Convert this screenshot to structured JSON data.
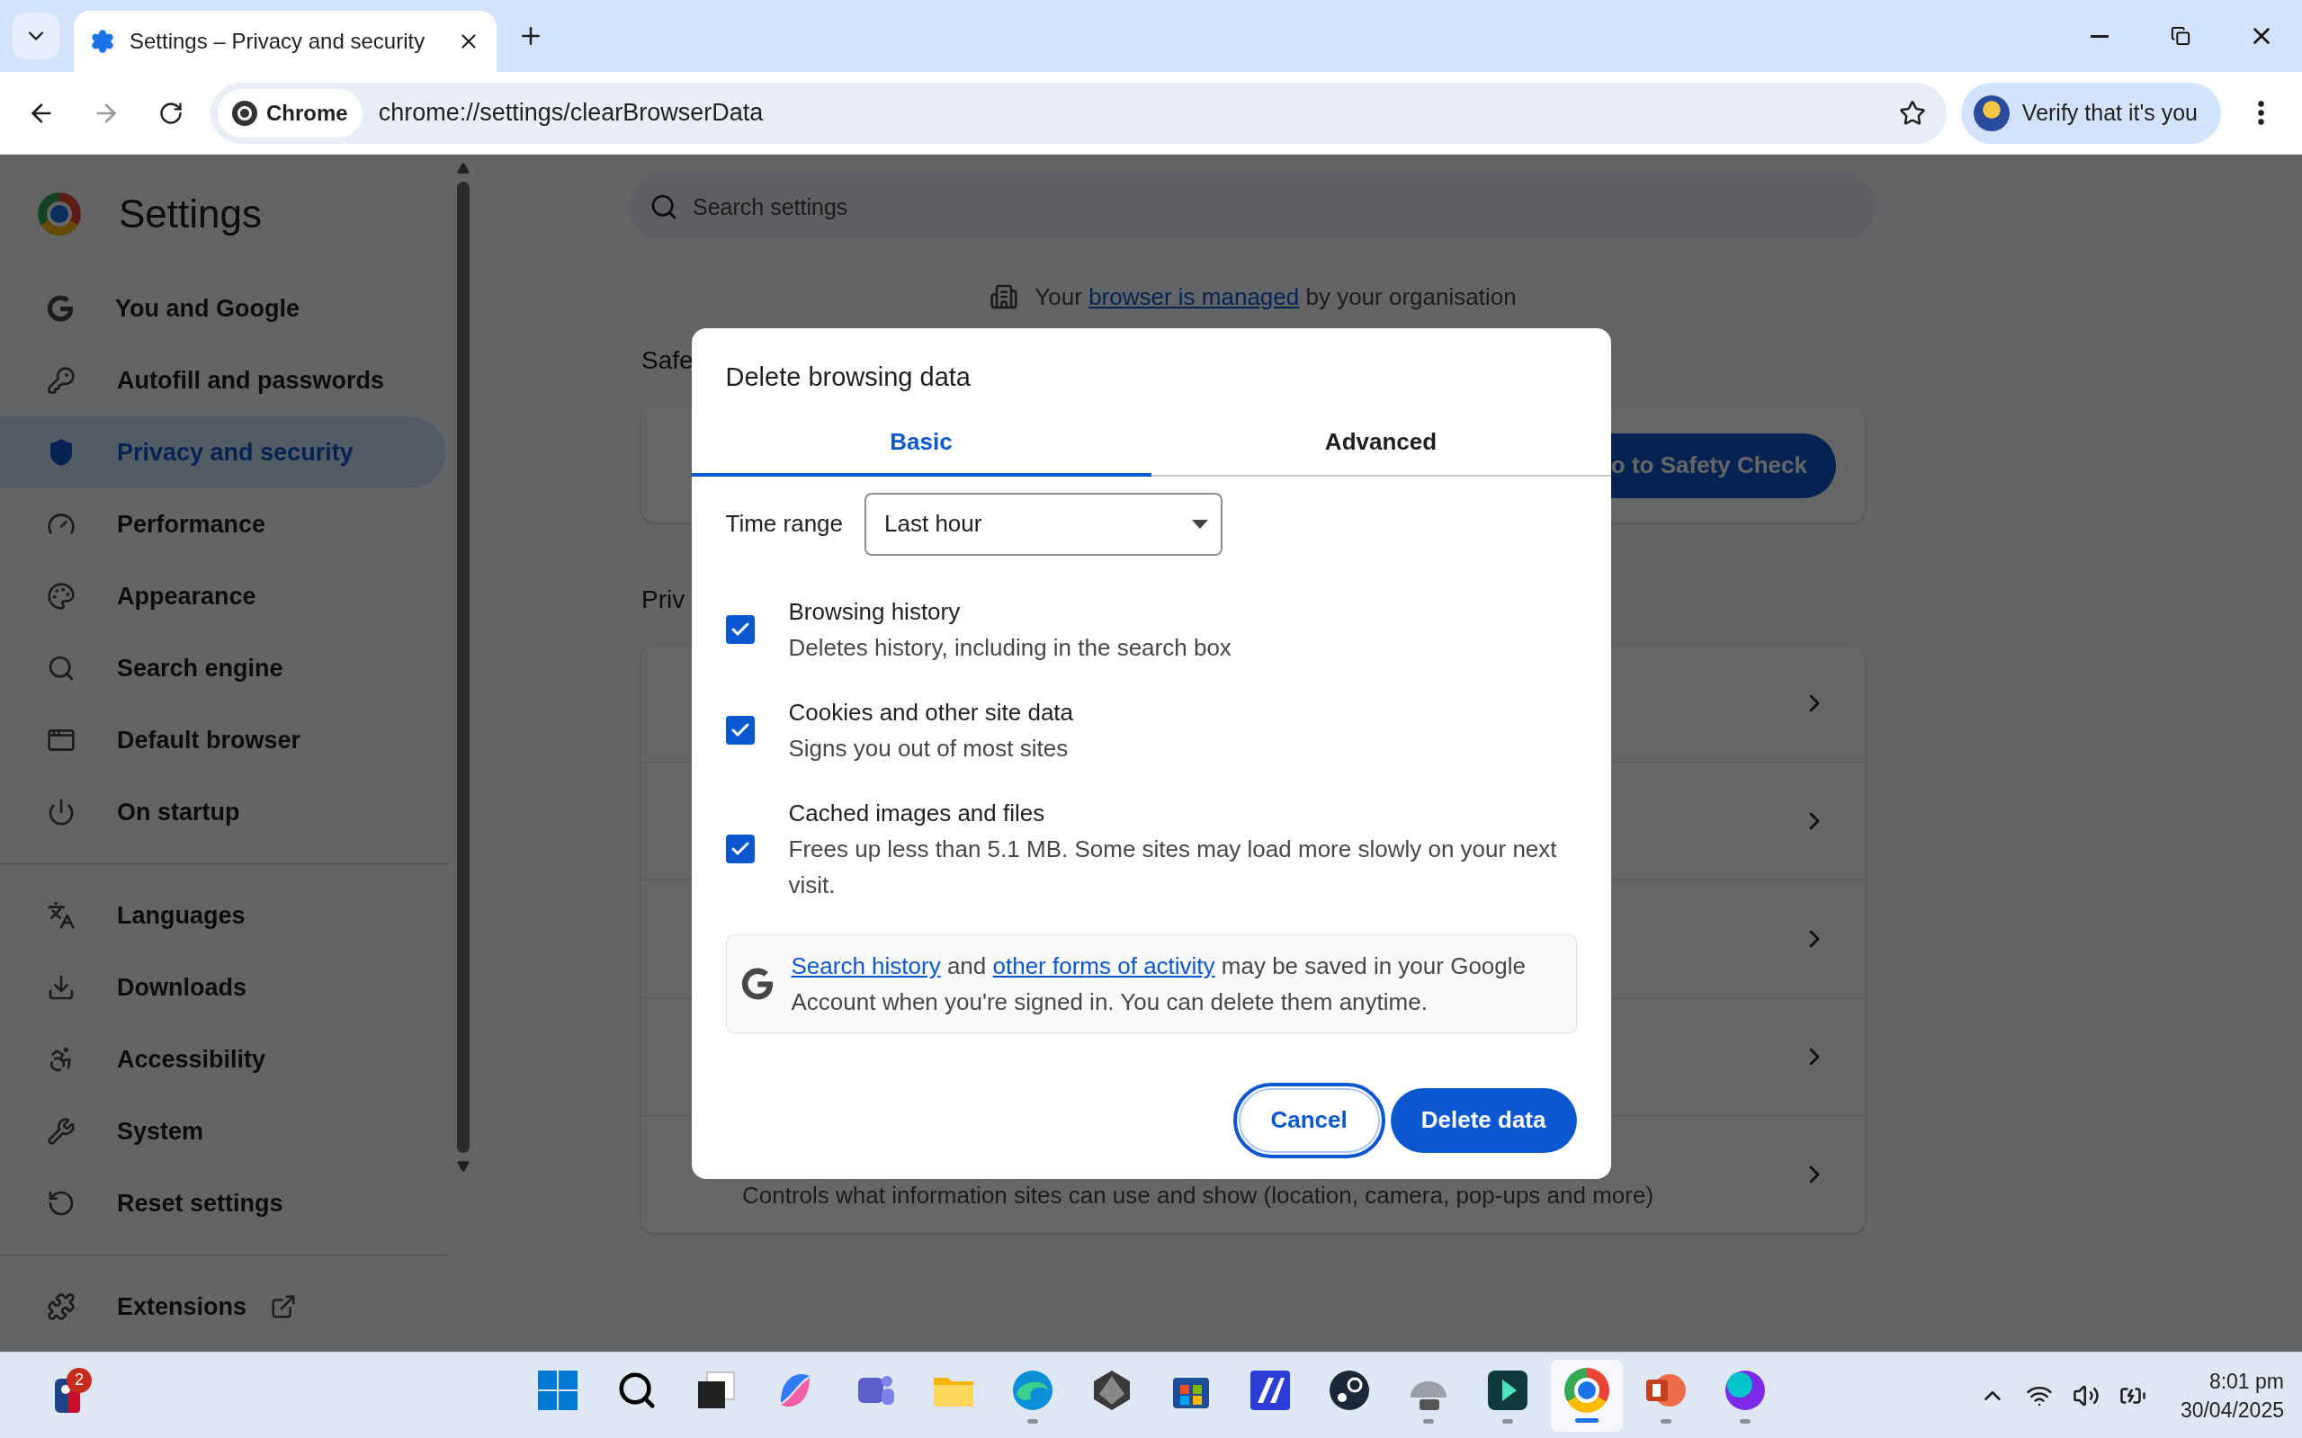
{
  "browser": {
    "tab_title": "Settings – Privacy and security",
    "chip": "Chrome",
    "url": "chrome://settings/clearBrowserData",
    "profile_label": "Verify that it's you"
  },
  "settings": {
    "title": "Settings",
    "search_placeholder": "Search settings",
    "managed_notice": [
      {
        "kind": "text",
        "text": "Your "
      },
      {
        "kind": "link",
        "text": "browser is managed"
      },
      {
        "kind": "text",
        "text": " by your organisation"
      }
    ],
    "sidebar": [
      {
        "items": [
          {
            "label": "You and Google",
            "selected": false,
            "kind": "page"
          },
          {
            "label": "Autofill and passwords",
            "selected": false,
            "kind": "page"
          },
          {
            "label": "Privacy and security",
            "selected": true,
            "kind": "page"
          },
          {
            "label": "Performance",
            "selected": false,
            "kind": "page"
          },
          {
            "label": "Appearance",
            "selected": false,
            "kind": "page"
          },
          {
            "label": "Search engine",
            "selected": false,
            "kind": "page"
          },
          {
            "label": "Default browser",
            "selected": false,
            "kind": "page"
          },
          {
            "label": "On startup",
            "selected": false,
            "kind": "page"
          }
        ]
      },
      {
        "items": [
          {
            "label": "Languages",
            "selected": false,
            "kind": "page"
          },
          {
            "label": "Downloads",
            "selected": false,
            "kind": "page"
          },
          {
            "label": "Accessibility",
            "selected": false,
            "kind": "page"
          },
          {
            "label": "System",
            "selected": false,
            "kind": "page"
          },
          {
            "label": "Reset settings",
            "selected": false,
            "kind": "page"
          }
        ]
      },
      {
        "items": [
          {
            "label": "Extensions",
            "selected": false,
            "kind": "external"
          }
        ]
      }
    ],
    "safety_heading": "Safe",
    "safety_button": "o to Safety Check",
    "privacy_heading": "Priv",
    "privacy_rows": [
      {
        "kind": "hidden"
      },
      {
        "kind": "hidden"
      },
      {
        "kind": "hidden"
      },
      {
        "kind": "hidden"
      },
      {
        "kind": "described",
        "description": "Controls what information sites can use and show (location, camera, pop-ups and more)"
      }
    ]
  },
  "dialog": {
    "title": "Delete browsing data",
    "tabs": [
      {
        "label": "Basic",
        "selected": true
      },
      {
        "label": "Advanced",
        "selected": false
      }
    ],
    "time_range_label": "Time range",
    "time_range_value": "Last hour",
    "options": [
      {
        "title": "Browsing history",
        "description": "Deletes history, including in the search box",
        "checked": true
      },
      {
        "title": "Cookies and other site data",
        "description": "Signs you out of most sites",
        "checked": true
      },
      {
        "title": "Cached images and files",
        "description": "Frees up less than 5.1 MB. Some sites may load more slowly on your next visit.",
        "checked": true
      }
    ],
    "notice": [
      {
        "kind": "link",
        "text": "Search history"
      },
      {
        "kind": "text",
        "text": " and "
      },
      {
        "kind": "link",
        "text": "other forms of activity"
      },
      {
        "kind": "text",
        "text": " may be saved in your Google Account when you're signed in. You can delete them anytime."
      }
    ],
    "buttons": [
      {
        "label": "Cancel",
        "kind": "secondary",
        "focused": true
      },
      {
        "label": "Delete data",
        "kind": "primary",
        "focused": false
      }
    ]
  },
  "taskbar": {
    "badge": "2",
    "apps": [
      {
        "running": false,
        "selected": false
      },
      {
        "running": false,
        "selected": false
      },
      {
        "running": false,
        "selected": false
      },
      {
        "running": false,
        "selected": false
      },
      {
        "running": false,
        "selected": false
      },
      {
        "running": false,
        "selected": false
      },
      {
        "running": true,
        "selected": false
      },
      {
        "running": false,
        "selected": false
      },
      {
        "running": false,
        "selected": false
      },
      {
        "running": false,
        "selected": false
      },
      {
        "running": false,
        "selected": false
      },
      {
        "running": true,
        "selected": false
      },
      {
        "running": true,
        "selected": false
      },
      {
        "running": true,
        "selected": true
      },
      {
        "running": true,
        "selected": false
      },
      {
        "running": true,
        "selected": false
      }
    ],
    "time": "8:01 pm",
    "date": "30/04/2025"
  }
}
